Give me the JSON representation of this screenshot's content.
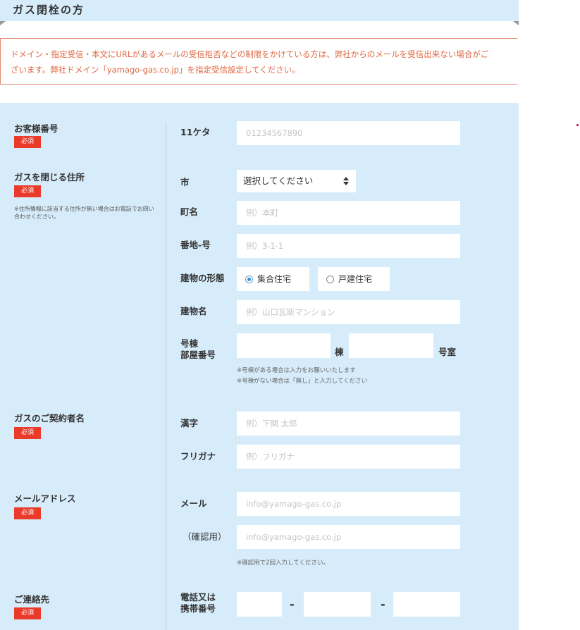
{
  "header": {
    "title": "ガス閉栓の方"
  },
  "notice": {
    "line1": "ドメイン・指定受信・本文にURLがあるメールの受信拒否などの制限をかけている方は、弊社からのメールを受信出来ない場合がご",
    "line2": "ざいます。弊社ドメイン「yamago-gas.co.jp」を指定受信設定してください。"
  },
  "required_label": "必須",
  "customer_number": {
    "section_label": "お客様番号",
    "field_label": "11ケタ",
    "placeholder": "01234567890"
  },
  "address": {
    "section_label": "ガスを閉じる住所",
    "note": "※住所情報に該当する住所が無い場合はお電話でお問い合わせください。",
    "city_label": "市",
    "city_selected": "選択してください",
    "town_label": "町名",
    "town_placeholder": "例）本町",
    "block_label": "番地-号",
    "block_placeholder": "例）3-1-1",
    "building_type_label": "建物の形態",
    "building_type_options": [
      "集合住宅",
      "戸建住宅"
    ],
    "building_type_selected": "集合住宅",
    "building_name_label": "建物名",
    "building_name_placeholder": "例）山口瓦斯マンション",
    "room_label_line1": "号棟",
    "room_label_line2": "部屋番号",
    "bldg_suffix": "棟",
    "room_suffix": "号室",
    "room_note1": "※号棟がある場合は入力をお願いいたします",
    "room_note2": "※号棟がない場合は「無し」と入力してください"
  },
  "contractor": {
    "section_label": "ガスのご契約者名",
    "kanji_label": "漢字",
    "kanji_placeholder": "例）下関 太郎",
    "kana_label": "フリガナ",
    "kana_placeholder": "例）フリガナ"
  },
  "email": {
    "section_label": "メールアドレス",
    "mail_label": "メール",
    "mail_placeholder": "info@yamago-gas.co.jp",
    "confirm_label": "（確認用）",
    "confirm_placeholder": "info@yamago-gas.co.jp",
    "note": "※確認用で2回入力してください。"
  },
  "contact": {
    "section_label": "ご連絡先",
    "phone_label_line1": "電話又は",
    "phone_label_line2": "携帯番号",
    "separator": "-"
  },
  "colors": {
    "panel_bg": "#d7ecfa",
    "required_bg": "#e93a2a",
    "notice_text": "#e0663f"
  }
}
